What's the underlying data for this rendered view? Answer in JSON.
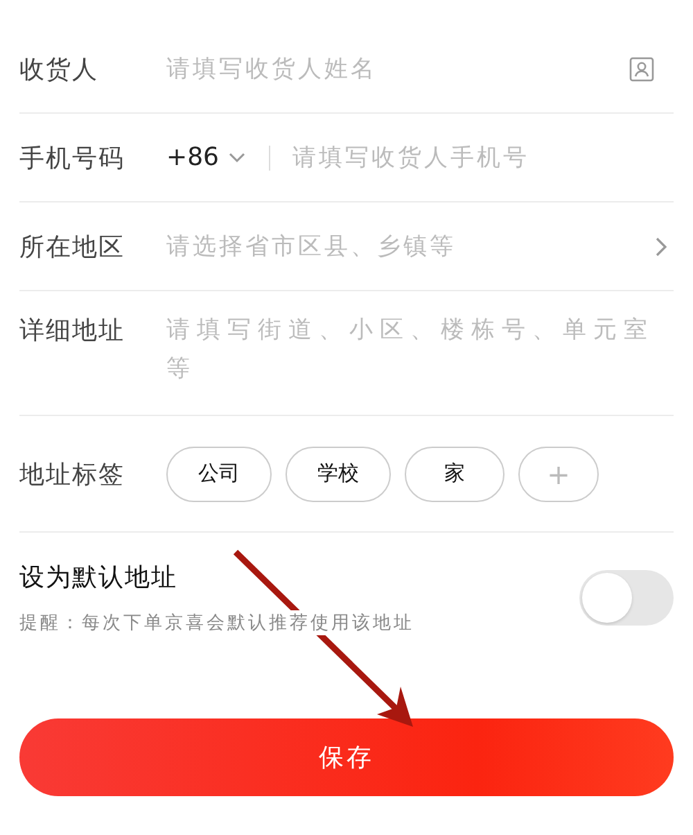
{
  "form_rows": [
    {
      "kind": "text",
      "label": "收货人",
      "placeholder": "请填写收货人姓名"
    },
    {
      "kind": "phone",
      "label": "手机号码",
      "country_code": "+86",
      "placeholder": "请填写收货人手机号"
    },
    {
      "kind": "picker",
      "label": "所在地区",
      "placeholder": "请选择省市区县、乡镇等"
    },
    {
      "kind": "textarea",
      "label": "详细地址",
      "placeholder": "请填写街道、小区、楼栋号、单元室等"
    },
    {
      "kind": "tags",
      "label": "地址标签",
      "tags": [
        {
          "label": "公司",
          "selected": false
        },
        {
          "label": "学校",
          "selected": false
        },
        {
          "label": "家",
          "selected": false
        }
      ],
      "add_label": "+"
    }
  ],
  "default_address": {
    "title": "设为默认地址",
    "hint": "提醒：每次下单京喜会默认推荐使用该地址",
    "on": false
  },
  "save_button": "保存"
}
